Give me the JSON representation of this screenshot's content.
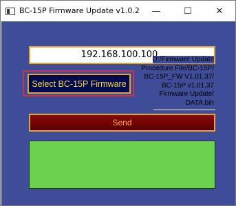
{
  "window": {
    "title": "BC-15P Firmware Update v1.0.2",
    "minimize_glyph": "—",
    "maximize_glyph": "☐",
    "close_glyph": "✕"
  },
  "form": {
    "ip_address": "192.168.100.100",
    "select_button_label": "Select BC-15P Firmware",
    "file_path": "D:/Firmware Update\nProcedure File/BC-15P/\nBC-15P_FW V1.01.37/\nBC-15P v1.01.37\nFirmware Update/\nDATA.bin",
    "send_button_label": "Send",
    "status_text": ""
  },
  "colors": {
    "client_background": "#3f4c98",
    "accent_border": "#e8a232",
    "select_button_bg": "#000a4e",
    "select_button_text": "#ffd84a",
    "send_button_bg": "#6e0505",
    "send_button_text": "#ffa64a",
    "status_box_bg": "#6bd14f",
    "focus_outline": "#c8344a"
  },
  "icons": {
    "app": "window-app-icon",
    "minimize": "minimize-icon",
    "maximize": "maximize-icon",
    "close": "close-icon"
  }
}
